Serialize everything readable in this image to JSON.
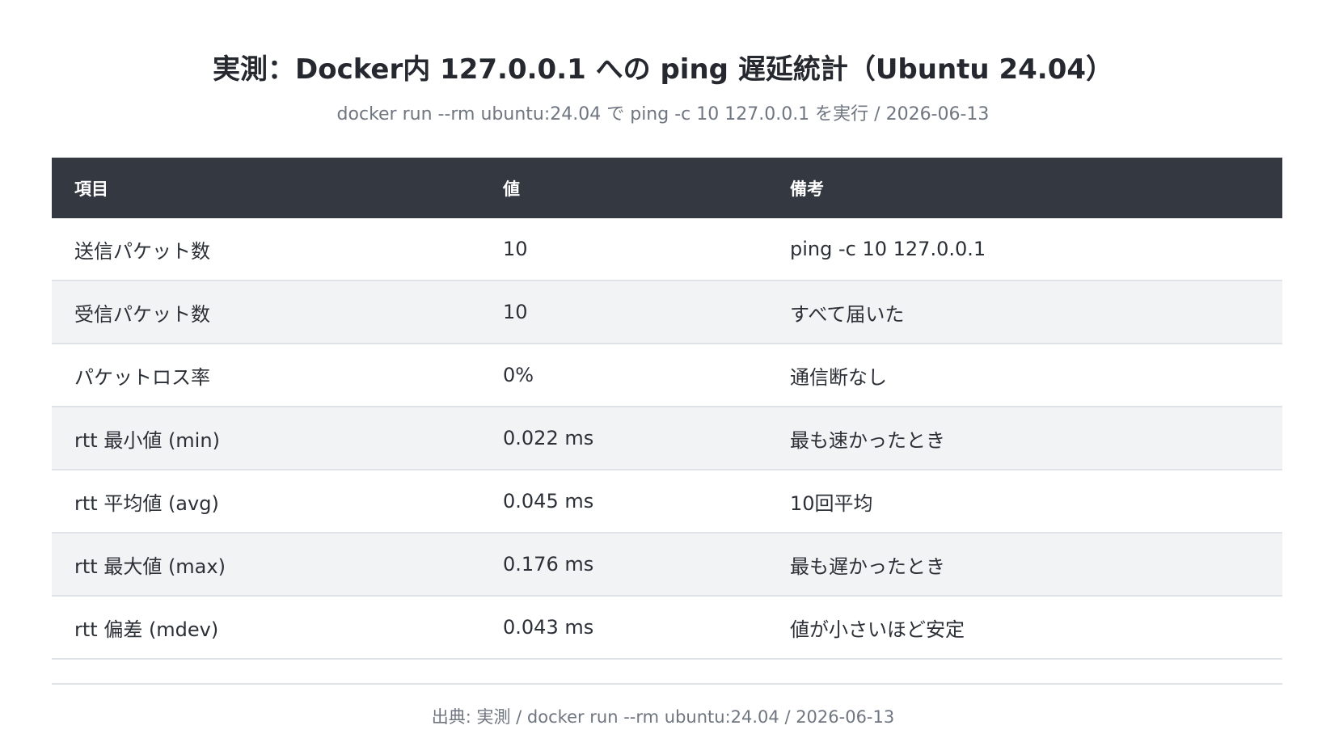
{
  "title": "実測：Docker内 127.0.0.1 への ping 遅延統計（Ubuntu 24.04）",
  "subtitle": "docker run --rm ubuntu:24.04 で ping -c 10 127.0.0.1 を実行 / 2026-06-13",
  "table": {
    "headers": [
      "項目",
      "値",
      "備考"
    ],
    "rows": [
      [
        "送信パケット数",
        "10",
        "ping -c 10 127.0.0.1"
      ],
      [
        "受信パケット数",
        "10",
        "すべて届いた"
      ],
      [
        "パケットロス率",
        "0%",
        "通信断なし"
      ],
      [
        "rtt 最小値 (min)",
        "0.022 ms",
        "最も速かったとき"
      ],
      [
        "rtt 平均値 (avg)",
        "0.045 ms",
        "10回平均"
      ],
      [
        "rtt 最大値 (max)",
        "0.176 ms",
        "最も遅かったとき"
      ],
      [
        "rtt 偏差 (mdev)",
        "0.043 ms",
        "値が小さいほど安定"
      ]
    ]
  },
  "footer": "出典: 実測 / docker run --rm ubuntu:24.04 / 2026-06-13",
  "colors": {
    "header_bg": "#343840",
    "alt_row_bg": "#f2f3f5",
    "divider": "#dfe2e6",
    "muted_text": "#6f7680"
  }
}
